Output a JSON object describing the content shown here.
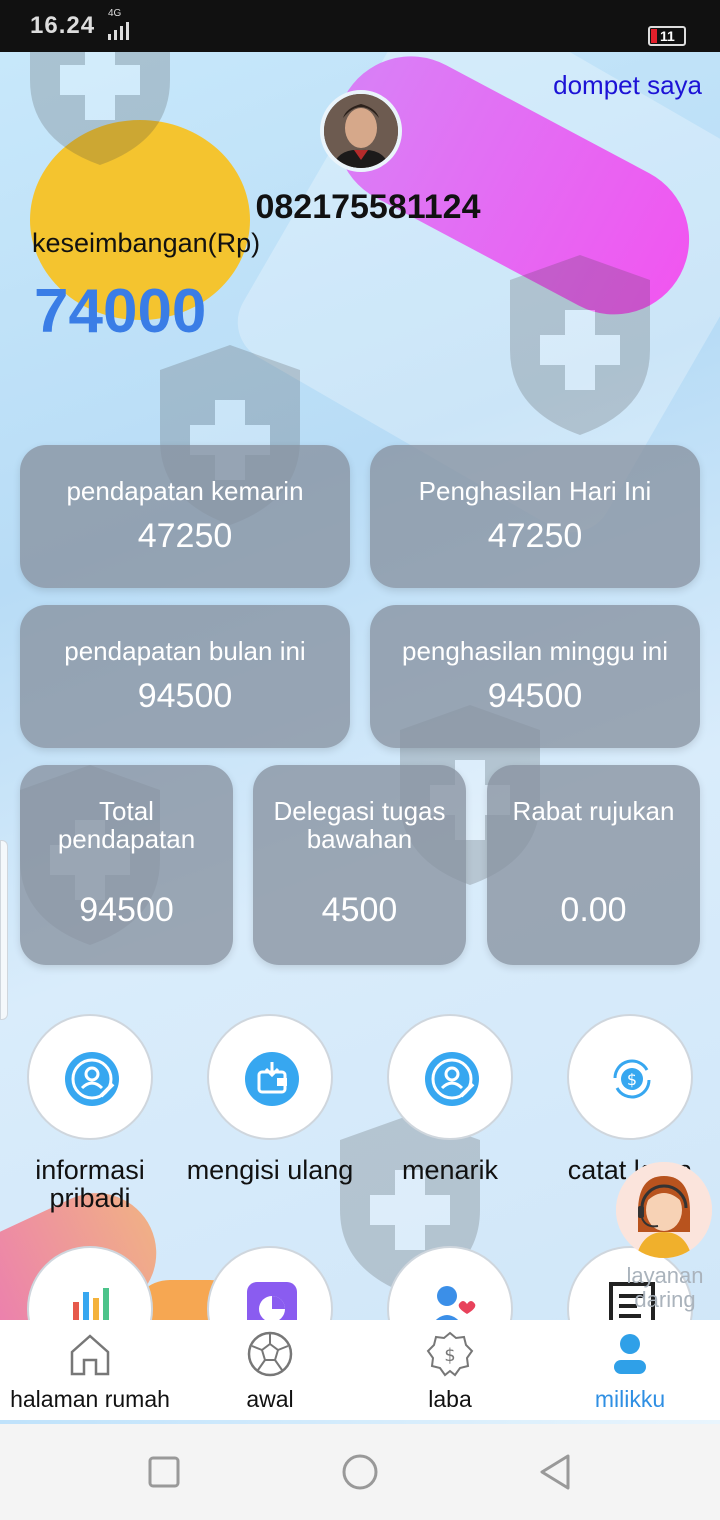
{
  "status_bar": {
    "time": "16.24",
    "network": "4G",
    "battery": "11"
  },
  "header": {
    "wallet_link": "dompet saya",
    "phone": "082175581124",
    "balance_label": "keseimbangan(Rp)",
    "balance_value": "74000"
  },
  "stats": {
    "row1": [
      {
        "label": "pendapatan kemarin",
        "value": "47250"
      },
      {
        "label": "Penghasilan Hari Ini",
        "value": "47250"
      }
    ],
    "row2": [
      {
        "label": "pendapatan bulan ini",
        "value": "94500"
      },
      {
        "label": "penghasilan minggu ini",
        "value": "94500"
      }
    ],
    "row3": [
      {
        "label": "Total pendapatan",
        "value": "94500"
      },
      {
        "label": "Delegasi tugas bawahan",
        "value": "4500"
      },
      {
        "label": "Rabat rujukan",
        "value": "0.00"
      }
    ]
  },
  "menu": [
    {
      "label": "informasi pribadi",
      "icon": "user-edit-icon"
    },
    {
      "label": "mengisi ulang",
      "icon": "wallet-download-icon"
    },
    {
      "label": "menarik",
      "icon": "user-edit-icon"
    },
    {
      "label": "catat keua",
      "icon": "dollar-refresh-icon"
    }
  ],
  "menu_row2_icons": [
    "bar-chart-icon",
    "pie-chart-icon",
    "user-heart-icon",
    "document-icon"
  ],
  "service": {
    "label": "layanan daring",
    "icon": "customer-service-agent-icon"
  },
  "tabbar": [
    {
      "label": "halaman rumah",
      "icon": "home-icon",
      "active": false
    },
    {
      "label": "awal",
      "icon": "soccer-ball-icon",
      "active": false
    },
    {
      "label": "laba",
      "icon": "dollar-badge-icon",
      "active": false
    },
    {
      "label": "milikku",
      "icon": "person-icon",
      "active": true
    }
  ],
  "colors": {
    "accent": "#2f8fe3",
    "balance": "#3a7de6",
    "link": "#1c12d6",
    "icon_bg": "#37a7f0"
  }
}
